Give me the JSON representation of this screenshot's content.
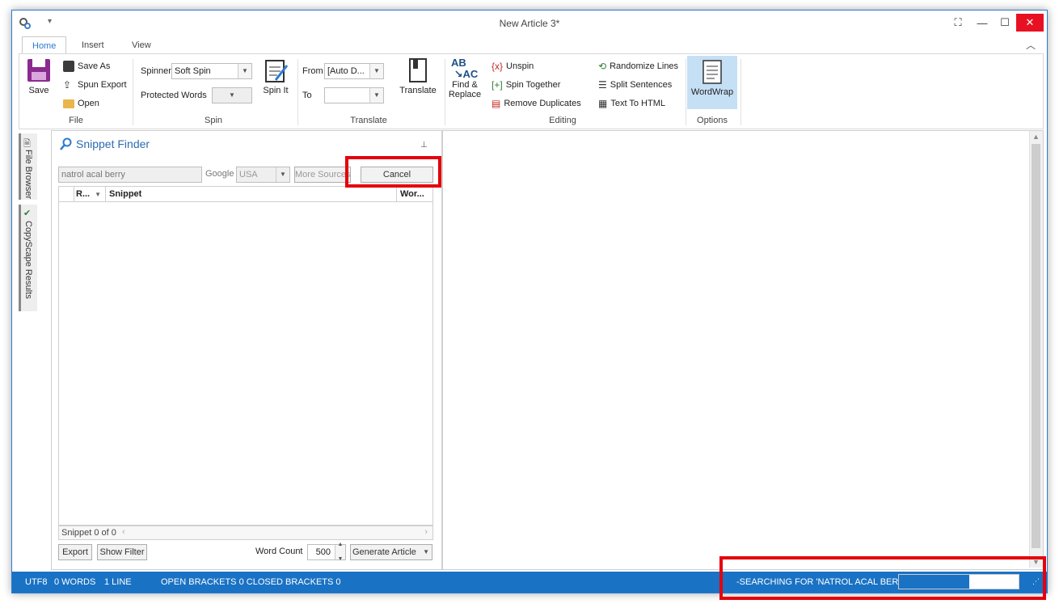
{
  "window": {
    "title": "New Article 3*"
  },
  "tabs": [
    {
      "label": "Home"
    },
    {
      "label": "Insert"
    },
    {
      "label": "View"
    }
  ],
  "ribbon": {
    "file": {
      "label": "File",
      "save": "Save",
      "save_as": "Save As",
      "spun_export": "Spun Export",
      "open": "Open"
    },
    "spin": {
      "label": "Spin",
      "spinner_label": "Spinner",
      "spinner_value": "Soft Spin",
      "protected_label": "Protected Words",
      "spin_it": "Spin It"
    },
    "translate": {
      "label": "Translate",
      "from_label": "From",
      "from_value": "[Auto D...",
      "to_label": "To",
      "to_value": "",
      "translate_btn": "Translate"
    },
    "editing": {
      "label": "Editing",
      "find_replace_line1": "Find &",
      "find_replace_line2": "Replace",
      "unspin": "Unspin",
      "spin_together": "Spin Together",
      "remove_duplicates": "Remove Duplicates",
      "randomize_lines": "Randomize Lines",
      "split_sentences": "Split Sentences",
      "text_to_html": "Text To HTML"
    },
    "options": {
      "label": "Options",
      "wordwrap": "WordWrap"
    }
  },
  "side_tabs": [
    {
      "label": "File Browser"
    },
    {
      "label": "CopyScape Results"
    }
  ],
  "snippet_finder": {
    "title": "Snippet Finder",
    "search_value": "natrol acal berry",
    "engine_label": "Google",
    "country": "USA",
    "more_sources": "More Sources",
    "cancel": "Cancel",
    "columns": [
      "R...",
      "Snippet",
      "Wor..."
    ],
    "count_text": "Snippet 0 of 0",
    "export": "Export",
    "show_filter": "Show Filter",
    "word_count_label": "Word Count",
    "word_count_value": "500",
    "generate_article": "Generate Article"
  },
  "status": {
    "encoding": "UTF8",
    "words": "0 WORDS",
    "lines": "1 LINE",
    "brackets": "OPEN BRACKETS 0 CLOSED BRACKETS 0",
    "searching": "-SEARCHING FOR 'NATROL ACAL BERRY'",
    "progress": 0.59
  },
  "colors": {
    "accent": "#2b7bd0",
    "status_bg": "#1a72c4",
    "highlight": "#e5000b",
    "close": "#e81123",
    "wordwrap_active": "#c5dff5"
  }
}
